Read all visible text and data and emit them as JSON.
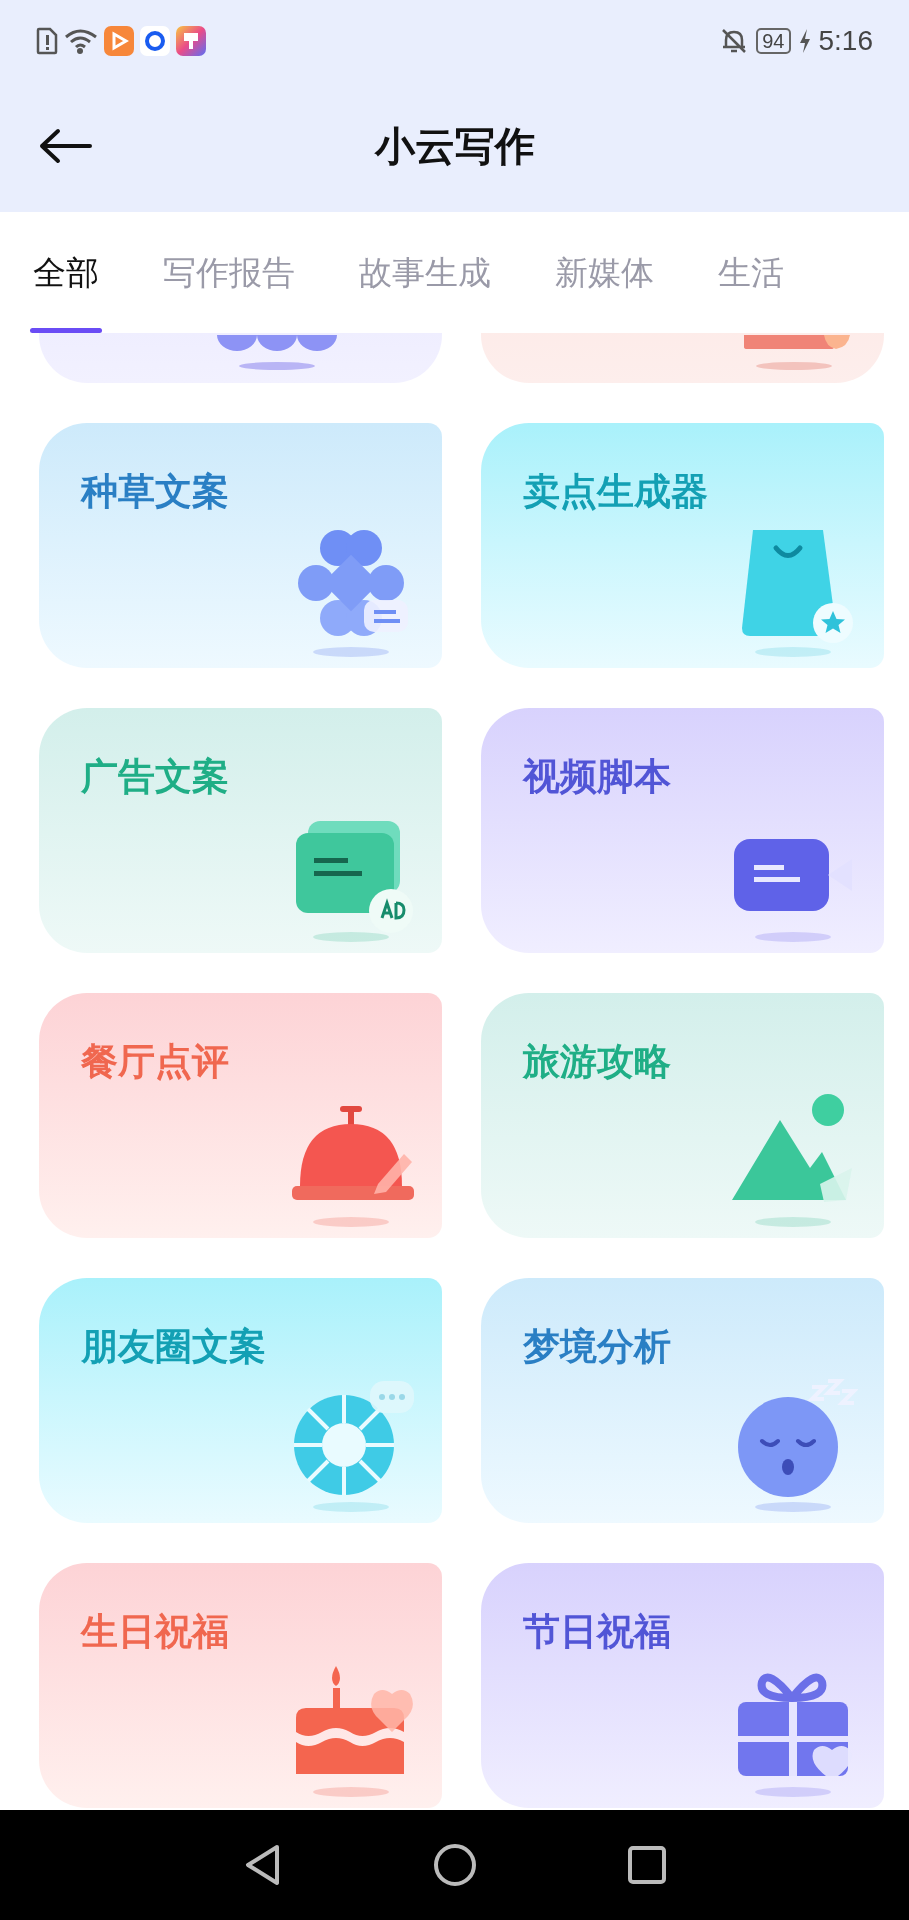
{
  "status_bar": {
    "time": "5:16",
    "battery": "94"
  },
  "header": {
    "title": "小云写作"
  },
  "tabs": [
    {
      "label": "全部",
      "selected": true
    },
    {
      "label": "写作报告",
      "selected": false
    },
    {
      "label": "故事生成",
      "selected": false
    },
    {
      "label": "新媒体",
      "selected": false
    },
    {
      "label": "生活",
      "selected": false
    }
  ],
  "cards": [
    {
      "title": "种草文案",
      "kind": "clover",
      "color": "#2a7fc4"
    },
    {
      "title": "卖点生成器",
      "kind": "bag",
      "color": "#13a0b4"
    },
    {
      "title": "广告文案",
      "kind": "ad",
      "color": "#1fae86"
    },
    {
      "title": "视频脚本",
      "kind": "video",
      "color": "#5155d6"
    },
    {
      "title": "餐厅点评",
      "kind": "bell",
      "color": "#f0674f"
    },
    {
      "title": "旅游攻略",
      "kind": "mountain",
      "color": "#1fae86"
    },
    {
      "title": "朋友圈文案",
      "kind": "aperture",
      "color": "#13a0b4"
    },
    {
      "title": "梦境分析",
      "kind": "moon",
      "color": "#2a7fc4"
    },
    {
      "title": "生日祝福",
      "kind": "cake",
      "color": "#f0674f"
    },
    {
      "title": "节日祝福",
      "kind": "gift",
      "color": "#5155d6"
    }
  ]
}
